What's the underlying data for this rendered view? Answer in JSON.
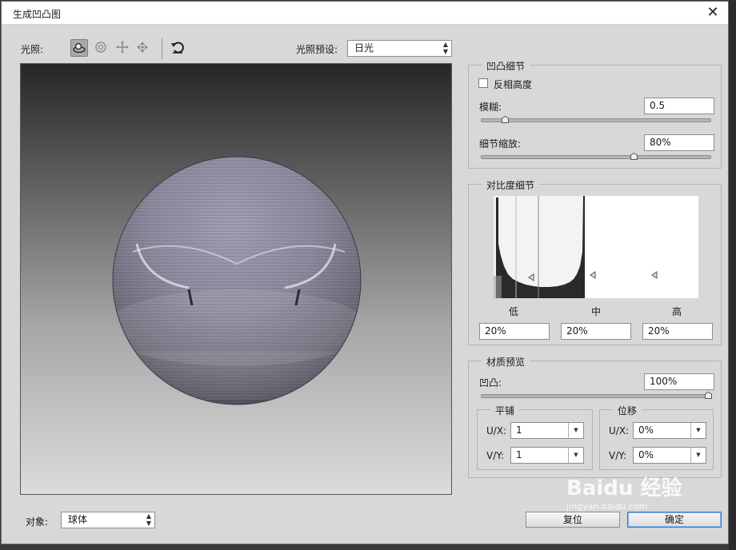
{
  "window": {
    "title": "生成凹凸图",
    "close_glyph": "✕"
  },
  "toolbar": {
    "light_label": "光照:",
    "preset_label": "光照预设:",
    "preset_value": "日光"
  },
  "bump_detail": {
    "title": "凹凸细节",
    "invert_label": "反相高度",
    "invert_checked": false,
    "blur_label": "模糊:",
    "blur_value": "0.5",
    "detail_scale_label": "细节缩放:",
    "detail_scale_value": "80%"
  },
  "contrast_detail": {
    "title": "对比度细节",
    "low_label": "低",
    "mid_label": "中",
    "high_label": "高",
    "low_value": "20%",
    "mid_value": "20%",
    "high_value": "20%"
  },
  "material_preview": {
    "title": "材质预览",
    "bump_label": "凹凸:",
    "bump_value": "100%",
    "tile_title": "平铺",
    "tile_ux_label": "U/X:",
    "tile_ux_value": "1",
    "tile_vy_label": "V/Y:",
    "tile_vy_value": "1",
    "offset_title": "位移",
    "offset_ux_label": "U/X:",
    "offset_ux_value": "0%",
    "offset_vy_label": "V/Y:",
    "offset_vy_value": "0%"
  },
  "object": {
    "label": "对象:",
    "value": "球体"
  },
  "buttons": {
    "reset": "复位",
    "ok": "确定"
  },
  "watermark": {
    "text": "Baidu 经验",
    "sub": "jingyan.baidu.com"
  }
}
